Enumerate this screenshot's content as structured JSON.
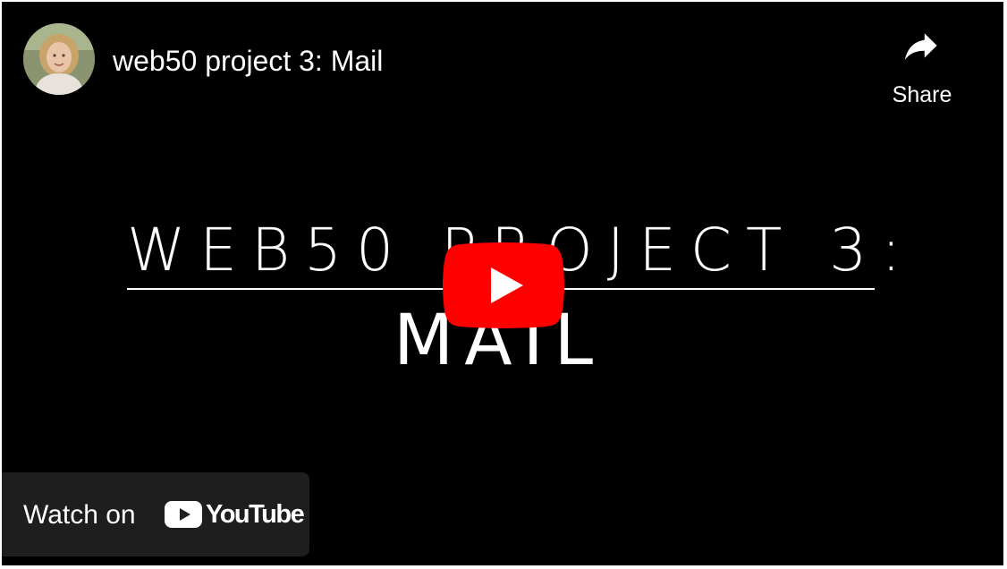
{
  "video": {
    "title": "web50 project 3: Mail",
    "channel_avatar": "channel-avatar-photo"
  },
  "share": {
    "label": "Share",
    "icon": "share-arrow-icon"
  },
  "title_card": {
    "line1": "WEB50 PROJECT 3:",
    "line2": "MAIL"
  },
  "play_button": {
    "icon": "play-icon",
    "color": "#ff0000"
  },
  "watch_on": {
    "label": "Watch on",
    "brand": "YouTube",
    "icon": "youtube-logo-icon"
  },
  "colors": {
    "background": "#000000",
    "text": "#ffffff",
    "youtube_red": "#ff0000"
  }
}
